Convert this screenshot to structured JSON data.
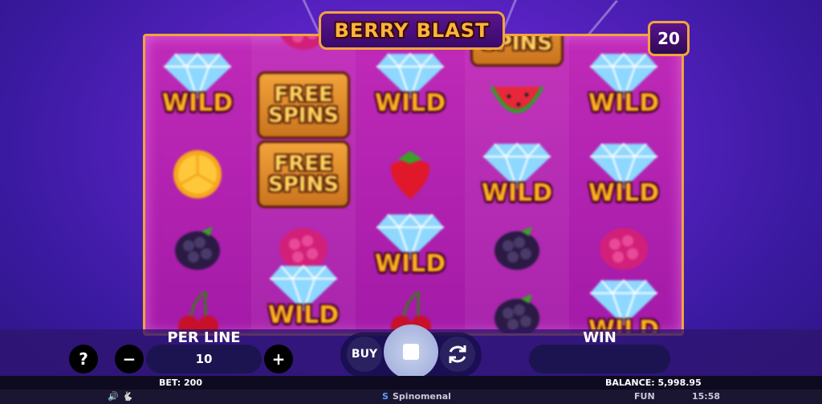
{
  "game": {
    "title": "BERRY BLAST",
    "lines": "20"
  },
  "reels": [
    [
      {
        "type": "wild"
      },
      {
        "type": "fruit",
        "name": "lemon"
      },
      {
        "type": "fruit",
        "name": "blackberry"
      },
      {
        "type": "fruit",
        "name": "cherry"
      }
    ],
    [
      {
        "type": "fruit",
        "name": "raspberry"
      },
      {
        "type": "freespins"
      },
      {
        "type": "freespins"
      },
      {
        "type": "fruit",
        "name": "raspberry"
      },
      {
        "type": "wild"
      }
    ],
    [
      {
        "type": "wild"
      },
      {
        "type": "fruit",
        "name": "strawberry"
      },
      {
        "type": "wild"
      },
      {
        "type": "fruit",
        "name": "cherry"
      }
    ],
    [
      {
        "type": "freespins"
      },
      {
        "type": "fruit",
        "name": "watermelon"
      },
      {
        "type": "wild"
      },
      {
        "type": "fruit",
        "name": "blackberry"
      },
      {
        "type": "fruit",
        "name": "blackberry"
      }
    ],
    [
      {
        "type": "wild"
      },
      {
        "type": "wild"
      },
      {
        "type": "fruit",
        "name": "raspberry"
      },
      {
        "type": "wild"
      }
    ]
  ],
  "symbols": {
    "wild_label": "WILD",
    "freespins_line1": "FREE",
    "freespins_line2": "SPINS"
  },
  "controls": {
    "help_label": "?",
    "per_line_label": "PER LINE",
    "per_line_value": "10",
    "minus_label": "−",
    "plus_label": "+",
    "buy_label": "BUY",
    "win_label": "WIN",
    "win_value": ""
  },
  "status": {
    "bet": "BET: 200",
    "balance": "BALANCE: 5,998.95"
  },
  "footer": {
    "brand": "Spinomenal",
    "mode": "FUN",
    "time": "15:58"
  },
  "colors": {
    "accent": "#f1a53a",
    "board": "#b020b0",
    "panel": "#2e146e"
  }
}
